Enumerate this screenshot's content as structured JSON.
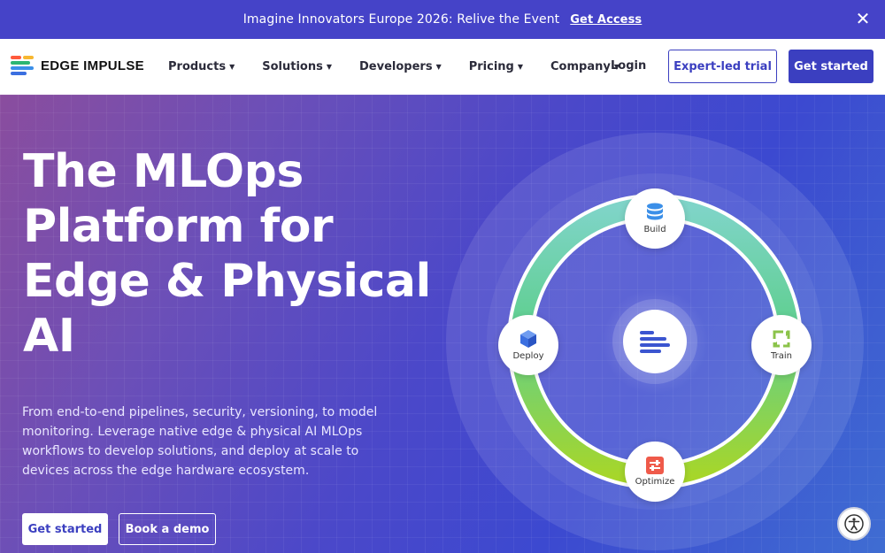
{
  "announcement": {
    "message": "Imagine Innovators Europe 2026: Relive the Event",
    "cta": "Get Access",
    "close_glyph": "✕"
  },
  "brand": {
    "name": "EDGE IMPULSE",
    "colors": [
      "#ff5a3c",
      "#f7b731",
      "#2bb673",
      "#3b8fe8"
    ]
  },
  "nav": {
    "items": [
      {
        "label": "Products"
      },
      {
        "label": "Solutions"
      },
      {
        "label": "Developers"
      },
      {
        "label": "Pricing"
      },
      {
        "label": "Company"
      }
    ],
    "caret": "▼",
    "login": "Login",
    "expert_trial": "Expert-led trial",
    "get_started": "Get started"
  },
  "hero": {
    "headline": "The MLOps Platform for Edge & Physical AI",
    "subtext": "From end-to-end pipelines, security, versioning, to model monitoring. Leverage native edge & physical AI MLOps workflows to develop solutions, and deploy at scale to devices across the edge hardware ecosystem.",
    "primary_cta": "Get started",
    "secondary_cta": "Book a demo"
  },
  "cycle": {
    "nodes": [
      {
        "label": "Build",
        "icon": "database-icon",
        "color": "#3b8fe8"
      },
      {
        "label": "Train",
        "icon": "refresh-icon",
        "color": "#8bc34a"
      },
      {
        "label": "Optimize",
        "icon": "sliders-icon",
        "color": "#ef5a4a"
      },
      {
        "label": "Deploy",
        "icon": "cube-icon",
        "color": "#3b6fe0"
      }
    ]
  },
  "colors": {
    "accent": "#3b3fc0",
    "announce_bg": "#4543c8"
  }
}
